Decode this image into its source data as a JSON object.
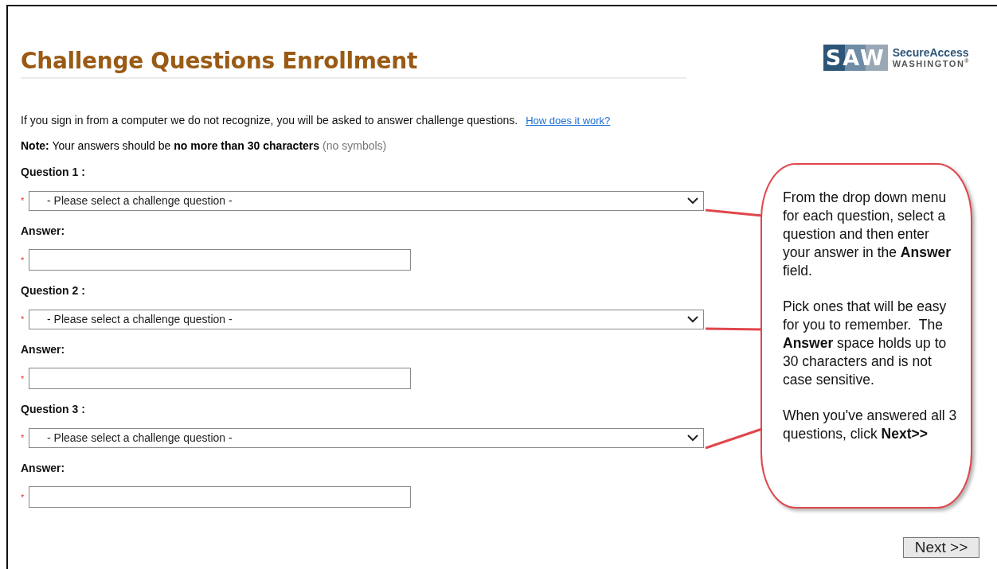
{
  "title": "Challenge Questions Enrollment",
  "logo": {
    "mark": "SAW",
    "name": "SecureAccess",
    "sub": "WASHINGTON",
    "reg": "®"
  },
  "intro": {
    "text": "If you sign in from a computer we do not recognize, you will be asked to answer challenge questions.",
    "link": "How does it work?"
  },
  "note": {
    "text": "**Note:** Your answers should be **no more than 30 characters**",
    "hint": "(no symbols)"
  },
  "questions": [
    {
      "label": "Question 1 :",
      "required_mark": "*",
      "select": {
        "value": "- Please select a challenge question -"
      },
      "answer_label": "Answer:",
      "answer_required_mark": "*"
    },
    {
      "label": "Question 2 :",
      "required_mark": "*",
      "select": {
        "value": "- Please select a challenge question -"
      },
      "answer_label": "Answer:",
      "answer_required_mark": "*"
    },
    {
      "label": "Question 3 :",
      "required_mark": "*",
      "select": {
        "value": "- Please select a challenge question -"
      },
      "answer_label": "Answer:",
      "answer_required_mark": "*"
    }
  ],
  "callout": {
    "paragraphs": [
      "From the drop down menu for each question, select a question and then enter your answer in the **Answer** field.",
      "Pick ones that will be easy for you to remember.  The **Answer** space holds up to 30 characters and is not case sensitive.",
      "When you've answered all 3 questions, click **Next>>**"
    ]
  },
  "next_button": "Next >>"
}
